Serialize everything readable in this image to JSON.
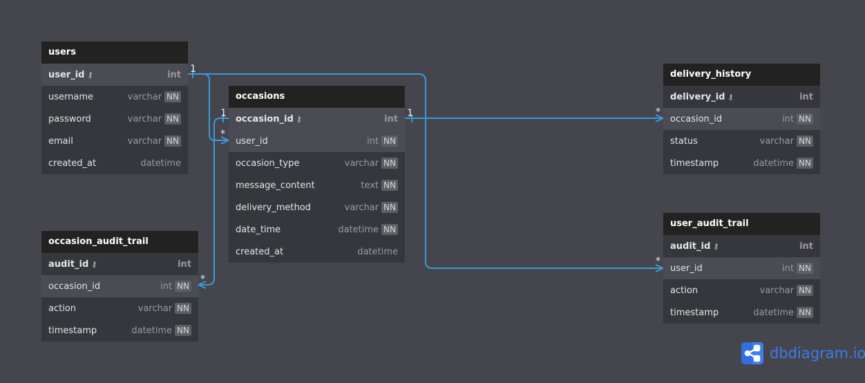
{
  "tables": {
    "users": {
      "name": "users",
      "cols": [
        {
          "n": "user_id",
          "t": "int",
          "pk": true
        },
        {
          "n": "username",
          "t": "varchar",
          "nn": "NN"
        },
        {
          "n": "password",
          "t": "varchar",
          "nn": "NN"
        },
        {
          "n": "email",
          "t": "varchar",
          "nn": "NN"
        },
        {
          "n": "created_at",
          "t": "datetime"
        }
      ]
    },
    "occasions": {
      "name": "occasions",
      "cols": [
        {
          "n": "occasion_id",
          "t": "int",
          "pk": true
        },
        {
          "n": "user_id",
          "t": "int",
          "nn": "NN"
        },
        {
          "n": "occasion_type",
          "t": "varchar",
          "nn": "NN"
        },
        {
          "n": "message_content",
          "t": "text",
          "nn": "NN"
        },
        {
          "n": "delivery_method",
          "t": "varchar",
          "nn": "NN"
        },
        {
          "n": "date_time",
          "t": "datetime",
          "nn": "NN"
        },
        {
          "n": "created_at",
          "t": "datetime"
        }
      ]
    },
    "delivery_history": {
      "name": "delivery_history",
      "cols": [
        {
          "n": "delivery_id",
          "t": "int",
          "pk": true
        },
        {
          "n": "occasion_id",
          "t": "int",
          "nn": "NN"
        },
        {
          "n": "status",
          "t": "varchar",
          "nn": "NN"
        },
        {
          "n": "timestamp",
          "t": "datetime",
          "nn": "NN"
        }
      ]
    },
    "user_audit_trail": {
      "name": "user_audit_trail",
      "cols": [
        {
          "n": "audit_id",
          "t": "int",
          "pk": true
        },
        {
          "n": "user_id",
          "t": "int",
          "nn": "NN"
        },
        {
          "n": "action",
          "t": "varchar",
          "nn": "NN"
        },
        {
          "n": "timestamp",
          "t": "datetime",
          "nn": "NN"
        }
      ]
    },
    "occasion_audit_trail": {
      "name": "occasion_audit_trail",
      "cols": [
        {
          "n": "audit_id",
          "t": "int",
          "pk": true
        },
        {
          "n": "occasion_id",
          "t": "int",
          "nn": "NN"
        },
        {
          "n": "action",
          "t": "varchar",
          "nn": "NN"
        },
        {
          "n": "timestamp",
          "t": "datetime",
          "nn": "NN"
        }
      ]
    }
  },
  "cardinality": {
    "one": "1",
    "many": "*"
  },
  "key_icon": "key-icon",
  "brand": {
    "name": "dbdiagram",
    "suffix": ".io",
    "color": "#3d7ce8"
  },
  "line_color": "#3a9ad9"
}
